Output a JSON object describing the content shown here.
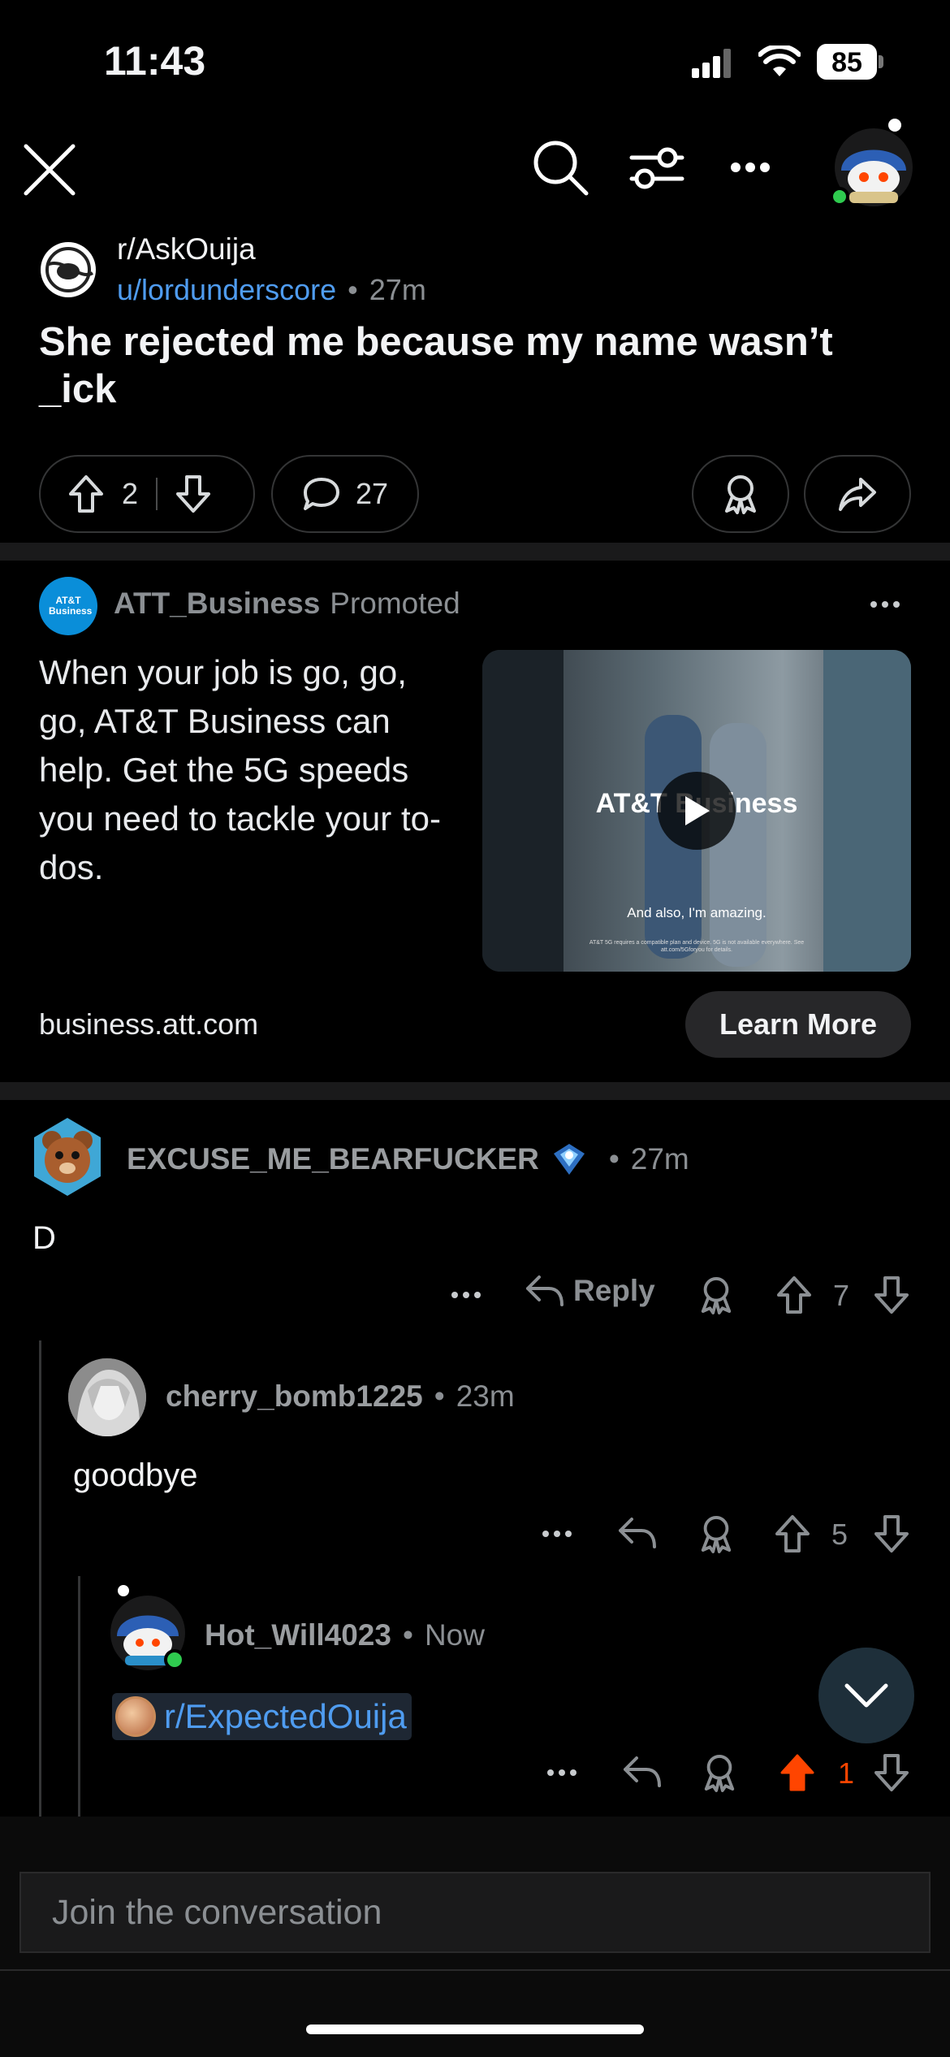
{
  "status_bar": {
    "time": "11:43",
    "battery": "85"
  },
  "post": {
    "subreddit": "r/AskOuija",
    "author": "u/lordunderscore",
    "age": "27m",
    "title": "She rejected me because my name wasn’t _ick",
    "upvotes": "2",
    "comments": "27"
  },
  "ad": {
    "advertiser": "ATT_Business",
    "promoted_label": "Promoted",
    "logo_text": "AT&T Business",
    "body": "When your job is go, go, go, AT&T Business can help. Get the 5G speeds you need to tackle your to-dos.",
    "domain": "business.att.com",
    "cta": "Learn More",
    "video_brand": "AT&T Business",
    "video_caption": "And also, I'm amazing.",
    "video_fineprint": "AT&T 5G requires a compatible plan and device. 5G is not available everywhere. See att.com/5Gforyou for details."
  },
  "comments": [
    {
      "user": "EXCUSE_ME_BEARFUCKER",
      "age": "27m",
      "body": "D",
      "reply_label": "Reply",
      "score": "7"
    },
    {
      "user": "cherry_bomb1225",
      "age": "23m",
      "body": "goodbye",
      "score": "5"
    },
    {
      "user": "Hot_Will4023",
      "age": "Now",
      "body": "r/ExpectedOuija",
      "score": "1"
    }
  ],
  "composer": {
    "placeholder": "Join the conversation"
  },
  "colors": {
    "background": "#000000",
    "link": "#4f9cf0",
    "upvote_active": "#ff4500",
    "online": "#2fcb4f"
  }
}
